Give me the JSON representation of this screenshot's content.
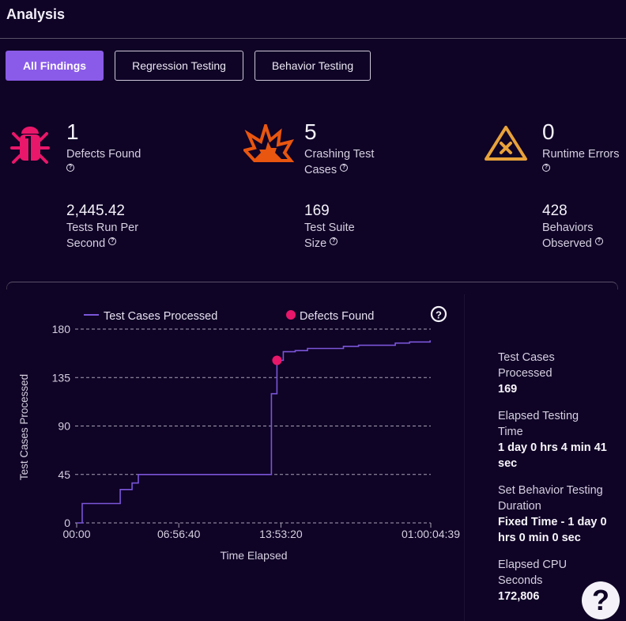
{
  "header": {
    "title": "Analysis"
  },
  "tabs": [
    {
      "label": "All Findings",
      "active": true
    },
    {
      "label": "Regression Testing",
      "active": false
    },
    {
      "label": "Behavior Testing",
      "active": false
    }
  ],
  "stats": {
    "defects": {
      "value": "1",
      "label": "Defects Found",
      "icon": "bug-icon",
      "color": "#e8176a"
    },
    "crashing": {
      "value": "5",
      "label_line1": "Crashing Test",
      "label_line2": "Cases",
      "icon": "explosion-icon",
      "color": "#e8560f"
    },
    "runtime": {
      "value": "0",
      "label": "Runtime Errors",
      "icon": "warning-x-icon",
      "color": "#e8a23a"
    },
    "tests_per_sec": {
      "value": "2,445.42",
      "label_line1": "Tests Run Per",
      "label_line2": "Second"
    },
    "suite_size": {
      "value": "169",
      "label_line1": "Test Suite",
      "label_line2": "Size"
    },
    "behaviors": {
      "value": "428",
      "label_line1": "Behaviors",
      "label_line2": "Observed"
    }
  },
  "help_glyph": "?",
  "side": {
    "tcp_k1": "Test Cases",
    "tcp_k2": "Processed",
    "tcp_v": "169",
    "elapsed_k1": "Elapsed Testing",
    "elapsed_k2": "Time",
    "elapsed_v1": "1 day 0 hrs 4 min 41",
    "elapsed_v2": "sec",
    "duration_k1": "Set Behavior Testing",
    "duration_k2": "Duration",
    "duration_v1": "Fixed Time - 1 day 0",
    "duration_v2": "hrs 0 min 0 sec",
    "cpu_k1": "Elapsed CPU",
    "cpu_k2": "Seconds",
    "cpu_v": "172,806"
  },
  "chart_data": {
    "type": "line",
    "step": true,
    "title": "",
    "xlabel": "Time Elapsed",
    "ylabel": "Test Cases Processed",
    "xlim_seconds": [
      0,
      86679
    ],
    "ylim": [
      0,
      180
    ],
    "grid": true,
    "legend_position": "top",
    "x_ticks": [
      {
        "value": 0,
        "label": "00:00"
      },
      {
        "value": 25000,
        "label": "06:56:40"
      },
      {
        "value": 50000,
        "label": "13:53:20"
      },
      {
        "value": 86679,
        "label": "01:00:04:39"
      }
    ],
    "y_ticks": [
      0,
      45,
      90,
      135,
      180
    ],
    "series": [
      {
        "name": "Test Cases Processed",
        "color": "#7a55d8",
        "points": [
          [
            0,
            0
          ],
          [
            1360,
            0
          ],
          [
            1360,
            18
          ],
          [
            10660,
            18
          ],
          [
            10660,
            31
          ],
          [
            13560,
            31
          ],
          [
            13560,
            37
          ],
          [
            15100,
            37
          ],
          [
            15100,
            45
          ],
          [
            47670,
            45
          ],
          [
            47670,
            120
          ],
          [
            49030,
            120
          ],
          [
            49030,
            151
          ],
          [
            50580,
            151
          ],
          [
            50580,
            159
          ],
          [
            53500,
            159
          ],
          [
            53500,
            160
          ],
          [
            56500,
            160
          ],
          [
            56500,
            162
          ],
          [
            65300,
            162
          ],
          [
            65300,
            164
          ],
          [
            69000,
            164
          ],
          [
            69000,
            165
          ],
          [
            78000,
            165
          ],
          [
            78000,
            167
          ],
          [
            81500,
            167
          ],
          [
            81500,
            168
          ],
          [
            86500,
            168
          ],
          [
            86500,
            169
          ],
          [
            86679,
            169
          ]
        ]
      },
      {
        "name": "Defects Found",
        "color": "#e8176a",
        "marker": "circle",
        "points": [
          [
            49030,
            151
          ]
        ]
      }
    ]
  }
}
